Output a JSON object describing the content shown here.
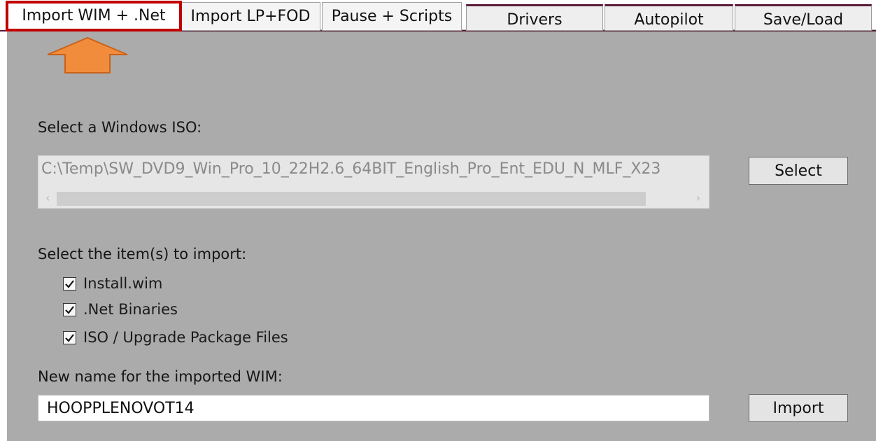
{
  "tabs": [
    {
      "label": "Import WIM + .Net",
      "active": true
    },
    {
      "label": "Import LP+FOD"
    },
    {
      "label": "Pause + Scripts"
    },
    {
      "label": "Drivers"
    },
    {
      "label": "Autopilot"
    },
    {
      "label": "Save/Load"
    }
  ],
  "iso": {
    "label": "Select a Windows ISO:",
    "path": "C:\\Temp\\SW_DVD9_Win_Pro_10_22H2.6_64BIT_English_Pro_Ent_EDU_N_MLF_X23",
    "select_button": "Select"
  },
  "items": {
    "label": "Select the item(s) to import:",
    "checkboxes": [
      {
        "label": "Install.wim",
        "checked": true
      },
      {
        "label": ".Net Binaries",
        "checked": true
      },
      {
        "label": "ISO / Upgrade Package Files",
        "checked": true
      }
    ]
  },
  "wim_name": {
    "label": "New name for the imported WIM:",
    "value": "HOOPPLENOVOT14",
    "import_button": "Import"
  },
  "colors": {
    "panel": "#ababab",
    "active_tab_border": "#c00000",
    "arrow": "#f08c3c",
    "tab_accent": "#5a1a38"
  },
  "icons": {
    "arrow": "up-arrow-icon",
    "check": "check-icon"
  }
}
